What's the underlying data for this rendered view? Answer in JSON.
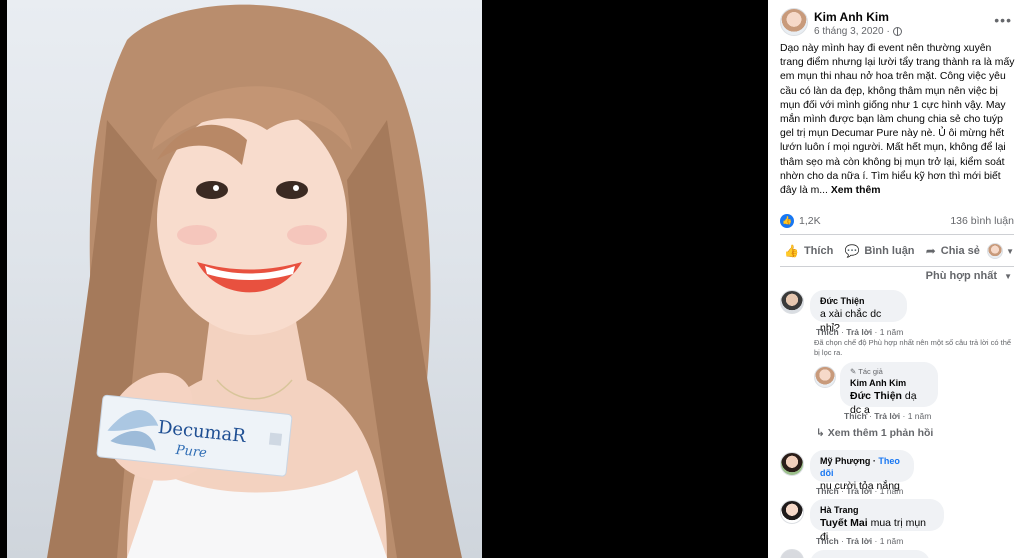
{
  "post": {
    "author": "Kim Anh Kim",
    "date": "6 tháng 3, 2020",
    "more_label": "•••",
    "text": "Dạo này mình hay đi event nên thường xuyên trang điểm nhưng lại lười tẩy trang thành ra là mấy em mụn thi nhau nở hoa trên mặt. Công việc yêu cầu có làn da đẹp, không thâm mụn nên việc bị mụn đối với mình giống như 1 cực hình vậy. May mắn mình được bạn làm chung chia sẻ cho tuýp gel trị mụn Decumar Pure này nè. Ủ ôi mừng hết lướn luôn í mọi người. Mất hết mụn, không để lại thâm sẹo mà còn không bị mụn trở lại, kiểm soát nhờn cho da nữa í. Tìm hiểu kỹ hơn thì mới biết đây là m...",
    "see_more": "Xem thêm",
    "like_count": "1,2K",
    "comment_count": "136 bình luận"
  },
  "actions": {
    "like": "Thích",
    "comment": "Bình luận",
    "share": "Chia sẻ"
  },
  "sort_label": "Phù hợp nhất",
  "comments": [
    {
      "name": "Đức Thiện",
      "text": "a xài chắc dc nhỉ?",
      "like": "Thích",
      "reply": "Trả lời",
      "time": "1 năm",
      "note": "Đã chọn chế độ Phù hợp nhất nên một số câu trả lời có thể bị lọc ra."
    },
    {
      "author_tag": "Tác giả",
      "name": "Kim Anh Kim",
      "mention": "Đức Thiện",
      "text": "dạ dc ạ",
      "like": "Thích",
      "reply": "Trả lời",
      "time": "1 năm"
    },
    {
      "view_replies": "Xem thêm 1 phản hồi"
    },
    {
      "name": "Mỹ Phượng",
      "follow": "Theo dõi",
      "text": "nụ cười tỏa nắng",
      "like": "Thích",
      "reply": "Trả lời",
      "time": "1 năm"
    },
    {
      "name": "Hà Trang",
      "mention": "Tuyết Mai",
      "text": "mua trị mụn đi",
      "like": "Thích",
      "reply": "Trả lời",
      "time": "1 năm"
    }
  ],
  "product": {
    "brand": "DecumaR",
    "sub": "Pure"
  },
  "colors": {
    "fb_blue": "#1877f2",
    "bubble": "#f0f2f5",
    "muted": "#65676b"
  }
}
